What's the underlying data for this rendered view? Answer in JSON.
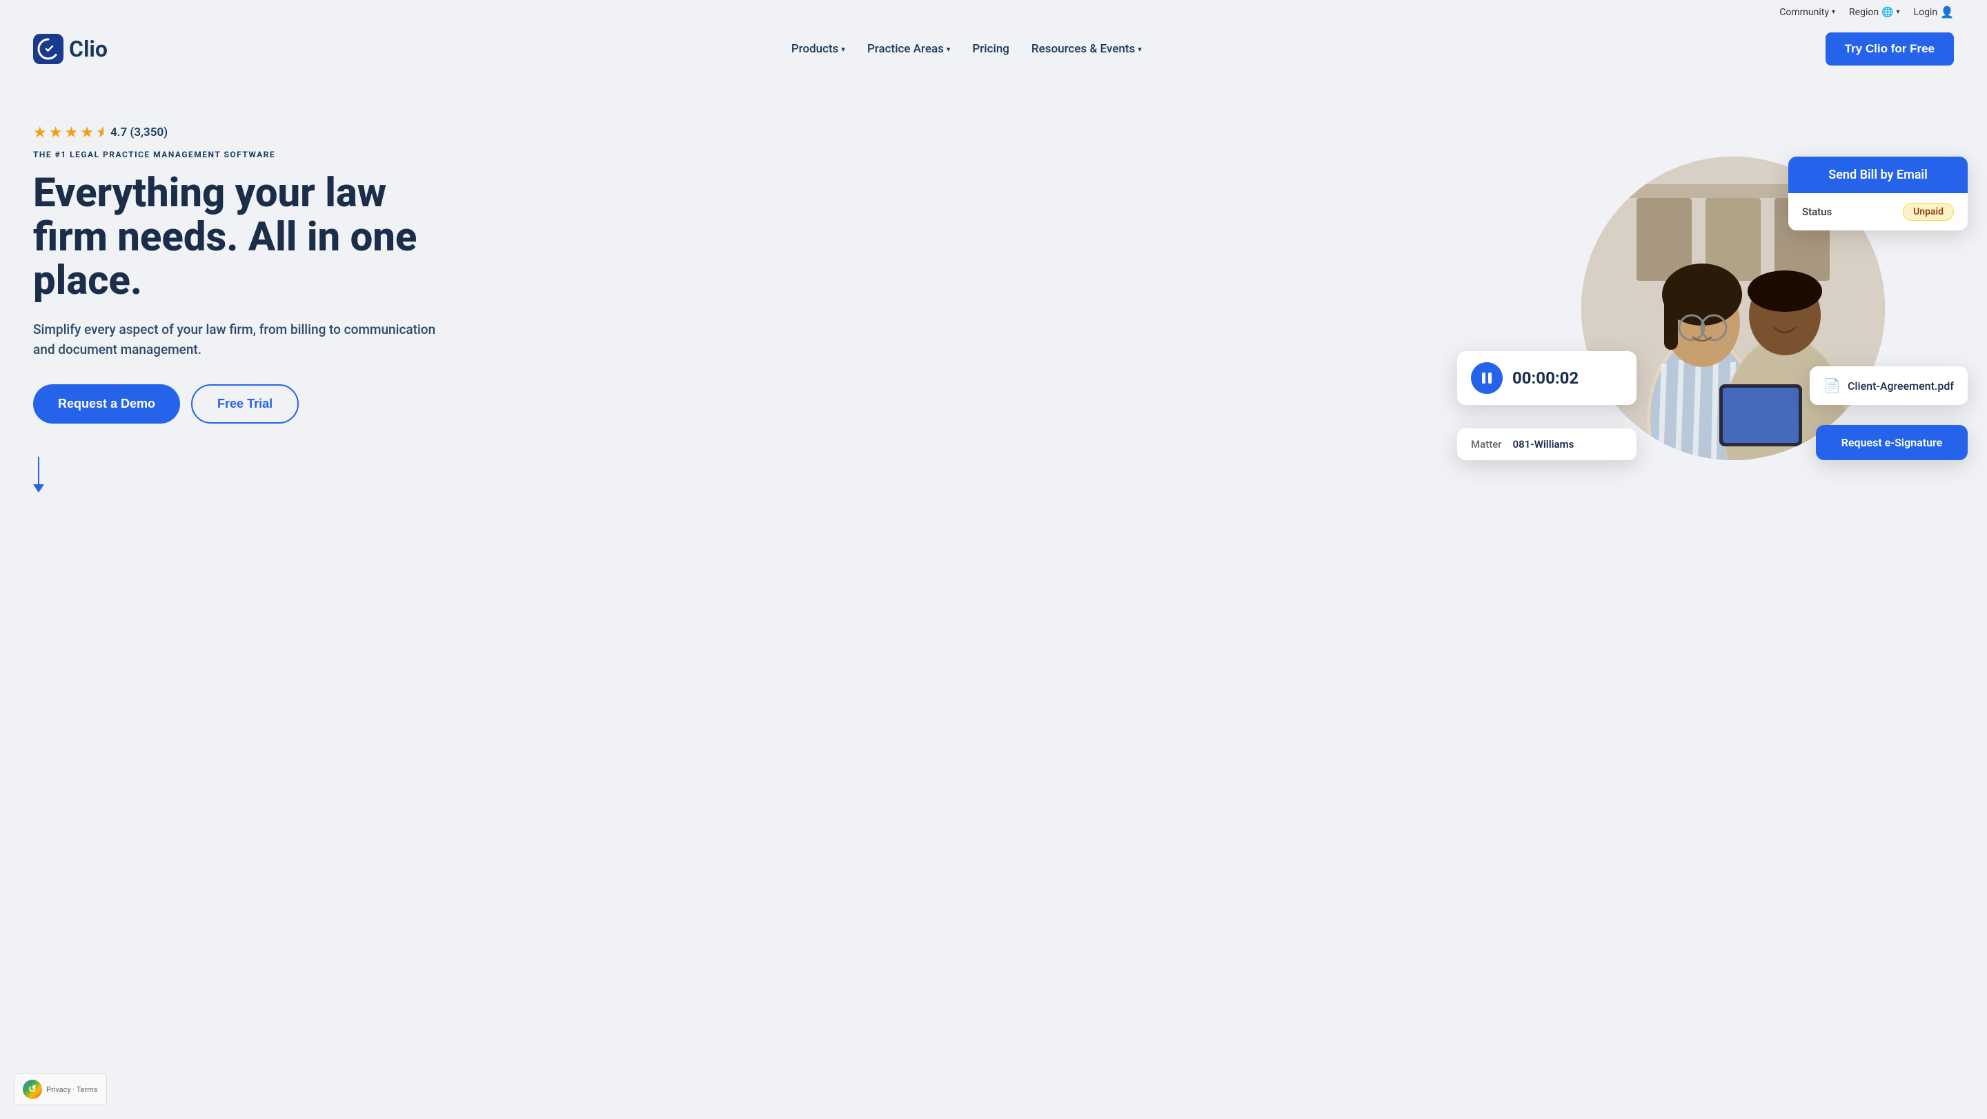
{
  "topbar": {
    "community_label": "Community",
    "region_label": "Region",
    "login_label": "Login"
  },
  "navbar": {
    "logo_text": "Clio",
    "products_label": "Products",
    "practice_areas_label": "Practice Areas",
    "pricing_label": "Pricing",
    "resources_label": "Resources & Events",
    "cta_label": "Try Clio for Free"
  },
  "hero": {
    "rating_value": "4.7 (3,350)",
    "badge": "THE #1 LEGAL PRACTICE MANAGEMENT SOFTWARE",
    "title_line1": "Everything your law",
    "title_line2": "firm needs. All in one",
    "title_line3": "place.",
    "subtitle": "Simplify every aspect of your law firm, from billing to communication and document management.",
    "btn_demo": "Request a Demo",
    "btn_trial": "Free Trial"
  },
  "ui_cards": {
    "timer_time": "00:00:02",
    "matter_label": "Matter",
    "matter_value": "081-Williams",
    "send_bill_label": "Send Bill by Email",
    "status_label": "Status",
    "status_value": "Unpaid",
    "doc_name": "Client-Agreement.pdf",
    "signature_label": "Request e-Signature"
  },
  "recaptcha": {
    "text": "Privacy · Terms"
  }
}
